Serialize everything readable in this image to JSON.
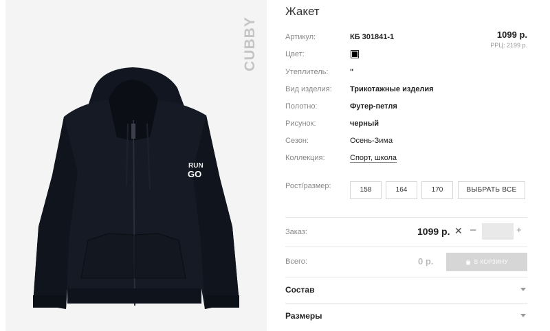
{
  "product": {
    "title": "Жакет",
    "brand": "CUBBY",
    "image_alt": "Black zip hoodie with RUN GO print",
    "print_text_line1": "RUN",
    "print_text_line2": "GO"
  },
  "pricing": {
    "price": "1099 р.",
    "rrp": "РРЦ: 2199 р."
  },
  "attributes": [
    {
      "label": "Артикул:",
      "value": "КБ 301841-1"
    },
    {
      "label": "Цвет:",
      "value": ""
    },
    {
      "label": "Утеплитель:",
      "value": "\""
    },
    {
      "label": "Вид изделия:",
      "value": "Трикотажные изделия"
    },
    {
      "label": "Полотно:",
      "value": "Футер-петля"
    },
    {
      "label": "Рисунок:",
      "value": "черный"
    },
    {
      "label": "Сезон:",
      "value": "Осень-Зима"
    },
    {
      "label": "Коллекция:",
      "value": "Спорт, школа"
    }
  ],
  "color_swatch": "#000000",
  "sizes": {
    "label": "Рост/размер:",
    "options": [
      "158",
      "164",
      "170"
    ],
    "select_all": "ВЫБРАТЬ ВСЕ"
  },
  "order": {
    "label": "Заказ:",
    "price": "1099 р.",
    "quantity": "",
    "minus": "–",
    "plus": "+",
    "times": "✕"
  },
  "total": {
    "label": "Всего:",
    "value": "0 р.",
    "cart_button": "В КОРЗИНУ"
  },
  "sections": [
    "Состав",
    "Размеры"
  ]
}
